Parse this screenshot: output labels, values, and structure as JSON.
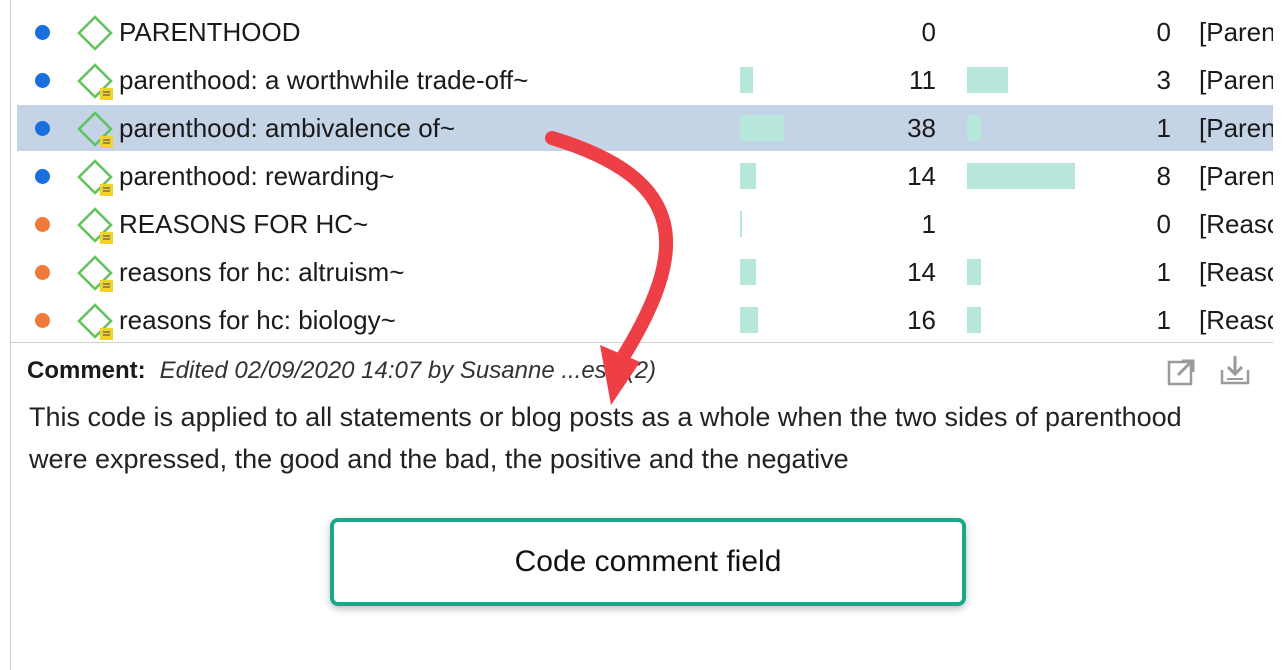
{
  "codes": [
    {
      "name": "PARENTHOOD",
      "count1": "0",
      "count2": "0",
      "group": "[Parenthood]",
      "color": "#1a6fe0",
      "has_memo": false,
      "frac1": 0.0,
      "frac2": 0.0,
      "selected": false
    },
    {
      "name": "parenthood: a worthwhile trade-off~",
      "count1": "11",
      "count2": "3",
      "group": "[Parenthood]",
      "color": "#1a6fe0",
      "has_memo": true,
      "frac1": 0.29,
      "frac2": 0.375,
      "selected": false
    },
    {
      "name": "parenthood: ambivalence of~",
      "count1": "38",
      "count2": "1",
      "group": "[Parenthood]",
      "color": "#1a6fe0",
      "has_memo": true,
      "frac1": 1.0,
      "frac2": 0.125,
      "selected": true
    },
    {
      "name": "parenthood: rewarding~",
      "count1": "14",
      "count2": "8",
      "group": "[Parenthood]",
      "color": "#1a6fe0",
      "has_memo": true,
      "frac1": 0.37,
      "frac2": 1.0,
      "selected": false
    },
    {
      "name": "REASONS FOR HC~",
      "count1": "1",
      "count2": "0",
      "group": "[Reasons]",
      "color": "#f07a3a",
      "has_memo": true,
      "frac1": 0.03,
      "frac2": 0.0,
      "selected": false
    },
    {
      "name": "reasons for hc: altruism~",
      "count1": "14",
      "count2": "1",
      "group": "[Reasons]",
      "color": "#f07a3a",
      "has_memo": true,
      "frac1": 0.37,
      "frac2": 0.125,
      "selected": false
    },
    {
      "name": "reasons for hc: biology~",
      "count1": "16",
      "count2": "1",
      "group": "[Reasons]",
      "color": "#f07a3a",
      "has_memo": true,
      "frac1": 0.42,
      "frac2": 0.125,
      "selected": false
    }
  ],
  "comment": {
    "label": "Comment:",
    "meta": "Edited 02/09/2020 14:07 by Susanne ...ese (2)",
    "text": "This code is applied to all statements or blog posts as a whole when the two sides of parenthood were expressed, the good and the bad, the positive and the negative"
  },
  "callout": {
    "text": "Code comment field"
  },
  "colors": {
    "selected_bg": "#c5d3e6",
    "bar": "#b7e6da",
    "code_icon": "#5cc45c",
    "memo_badge": "#f2d12a",
    "arrow": "#ef3f46",
    "callout_border": "#1aa88a"
  }
}
